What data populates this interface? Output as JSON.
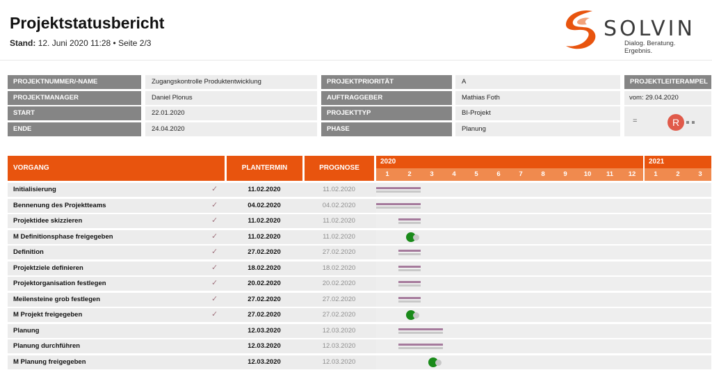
{
  "header": {
    "title": "Projektstatusbericht",
    "stand_label": "Stand:",
    "stand_value": "12. Juni 2020 11:28 • Seite 2/3"
  },
  "logo": {
    "word": "SOLVIN",
    "tagline": "Dialog. Beratung. Ergebnis.",
    "colors": {
      "swirl": "#e8540e",
      "text": "#3a3a3a"
    }
  },
  "info": {
    "projektnummer_label": "PROJEKTNUMMER/-NAME",
    "projektnummer_value": "Zugangskontrolle Produktentwicklung",
    "projektmanager_label": "PROJEKTMANAGER",
    "projektmanager_value": "Daniel Plonus",
    "start_label": "START",
    "start_value": "22.01.2020",
    "ende_label": "ENDE",
    "ende_value": "24.04.2020",
    "prioritaet_label": "PROJEKTPRIORITÄT",
    "prioritaet_value": "A",
    "auftraggeber_label": "AUFTRAGGEBER",
    "auftraggeber_value": "Mathias Foth",
    "projekttyp_label": "PROJEKTTYP",
    "projekttyp_value": "BI-Projekt",
    "phase_label": "PHASE",
    "phase_value": "Planung",
    "ampel_label": "PROJEKTLEITERAMPEL",
    "ampel_date": "vom: 29.04.2020",
    "ampel_trend": "=",
    "ampel_status": "R",
    "ampel_color": "#e05a4a"
  },
  "table": {
    "col_vorgang": "VORGANG",
    "col_plantermin": "PLANTERMIN",
    "col_prognose": "PROGNOSE",
    "year_2020": "2020",
    "year_2021": "2021",
    "months_2020": [
      "1",
      "2",
      "3",
      "4",
      "5",
      "6",
      "7",
      "8",
      "9",
      "10",
      "11",
      "12"
    ],
    "months_2021": [
      "1",
      "2",
      "3"
    ],
    "check_glyph": "✓",
    "colors": {
      "header": "#e8540e",
      "month_row": "#f08a4e",
      "plan_bar": "#a57a9c",
      "prog_bar": "#c8c8c8",
      "milestone": "#1a8a1a"
    },
    "rows": [
      {
        "name": "Initialisierung",
        "done": true,
        "plan": "11.02.2020",
        "prog": "11.02.2020",
        "milestone": false,
        "start_month": 0.0,
        "end_month": 2.0
      },
      {
        "name": "Bennenung des Projektteams",
        "done": true,
        "plan": "04.02.2020",
        "prog": "04.02.2020",
        "milestone": false,
        "start_month": 0.0,
        "end_month": 2.0
      },
      {
        "name": "Projektidee skizzieren",
        "done": true,
        "plan": "11.02.2020",
        "prog": "11.02.2020",
        "milestone": false,
        "start_month": 1.0,
        "end_month": 2.0
      },
      {
        "name": "M Definitionsphase freigegeben",
        "done": true,
        "plan": "11.02.2020",
        "prog": "11.02.2020",
        "milestone": true,
        "start_month": 1.35,
        "end_month": 1.35
      },
      {
        "name": "Definition",
        "done": true,
        "plan": "27.02.2020",
        "prog": "27.02.2020",
        "milestone": false,
        "start_month": 1.0,
        "end_month": 2.0
      },
      {
        "name": "Projektziele definieren",
        "done": true,
        "plan": "18.02.2020",
        "prog": "18.02.2020",
        "milestone": false,
        "start_month": 1.0,
        "end_month": 2.0
      },
      {
        "name": "Projektorganisation festlegen",
        "done": true,
        "plan": "20.02.2020",
        "prog": "20.02.2020",
        "milestone": false,
        "start_month": 1.0,
        "end_month": 2.0
      },
      {
        "name": "Meilensteine grob festlegen",
        "done": true,
        "plan": "27.02.2020",
        "prog": "27.02.2020",
        "milestone": false,
        "start_month": 1.0,
        "end_month": 2.0
      },
      {
        "name": "M Projekt freigegeben",
        "done": true,
        "plan": "27.02.2020",
        "prog": "27.02.2020",
        "milestone": true,
        "start_month": 1.35,
        "end_month": 1.35
      },
      {
        "name": "Planung",
        "done": false,
        "plan": "12.03.2020",
        "prog": "12.03.2020",
        "milestone": false,
        "start_month": 1.0,
        "end_month": 3.0
      },
      {
        "name": "Planung durchführen",
        "done": false,
        "plan": "12.03.2020",
        "prog": "12.03.2020",
        "milestone": false,
        "start_month": 1.0,
        "end_month": 3.0
      },
      {
        "name": "M Planung freigegeben",
        "done": false,
        "plan": "12.03.2020",
        "prog": "12.03.2020",
        "milestone": true,
        "start_month": 2.35,
        "end_month": 2.35
      }
    ]
  }
}
